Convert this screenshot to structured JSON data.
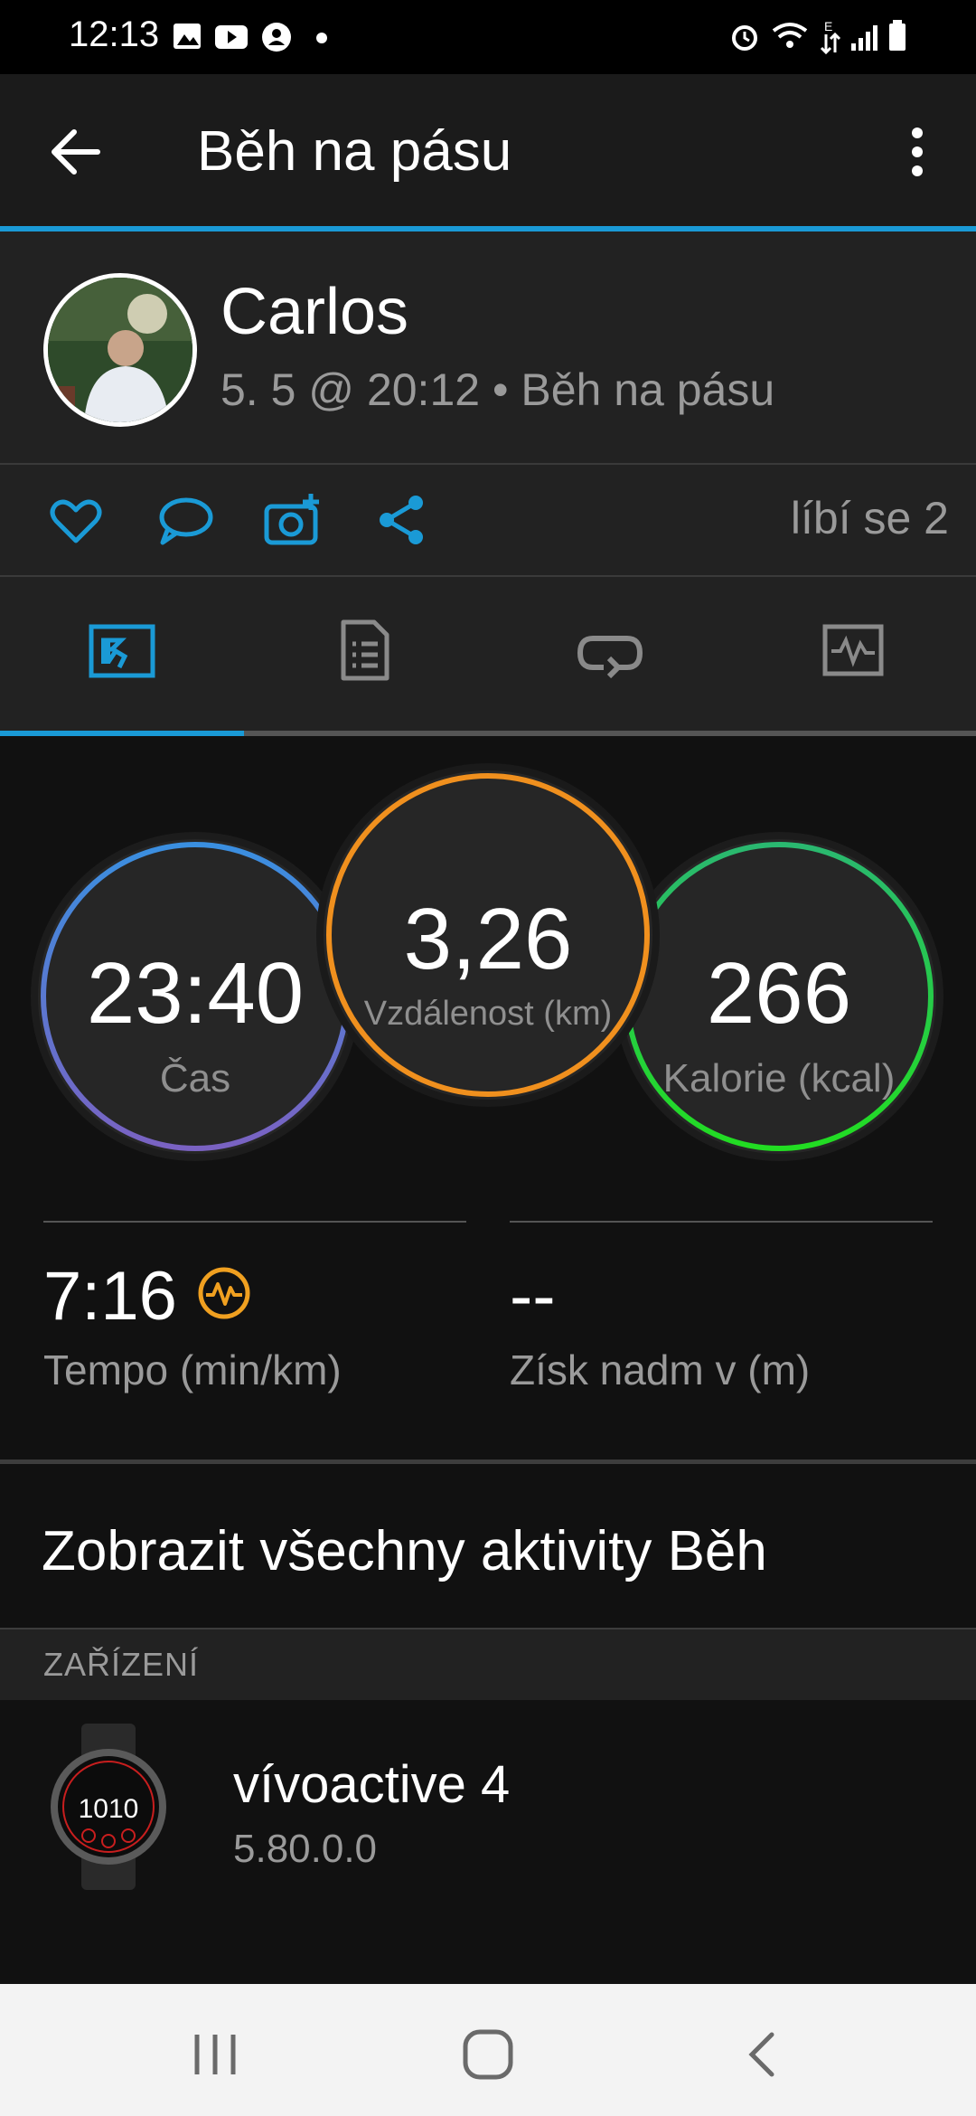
{
  "status_bar": {
    "time": "12:13"
  },
  "app_bar": {
    "title": "Běh na pásu"
  },
  "profile": {
    "name": "Carlos",
    "meta": "5. 5 @ 20:12 • Běh na pásu"
  },
  "actions": {
    "likes": "líbí se 2"
  },
  "circles": [
    {
      "value": "23:40",
      "label": "Čas"
    },
    {
      "value": "3,26",
      "label": "Vzdálenost (km)"
    },
    {
      "value": "266",
      "label": "Kalorie (kcal)"
    }
  ],
  "stats": [
    {
      "value": "7:16",
      "label": "Tempo (min/km)"
    },
    {
      "value": "--",
      "label": "Získ nadm v (m)"
    }
  ],
  "all_activities": {
    "label": "Zobrazit všechny aktivity Běh"
  },
  "devices": {
    "header": "ZAŘÍZENÍ",
    "device_name": "vívoactive 4",
    "version": "5.80.0.0",
    "watch_face_time": "1010"
  },
  "colors": {
    "accent": "#1a9ad6",
    "ring_time_top": "#3a8fe0",
    "ring_time_bottom": "#7a62c2",
    "ring_distance": "#f0901e",
    "ring_calories": "#22dd22",
    "tempo_icon": "#f0a020"
  }
}
